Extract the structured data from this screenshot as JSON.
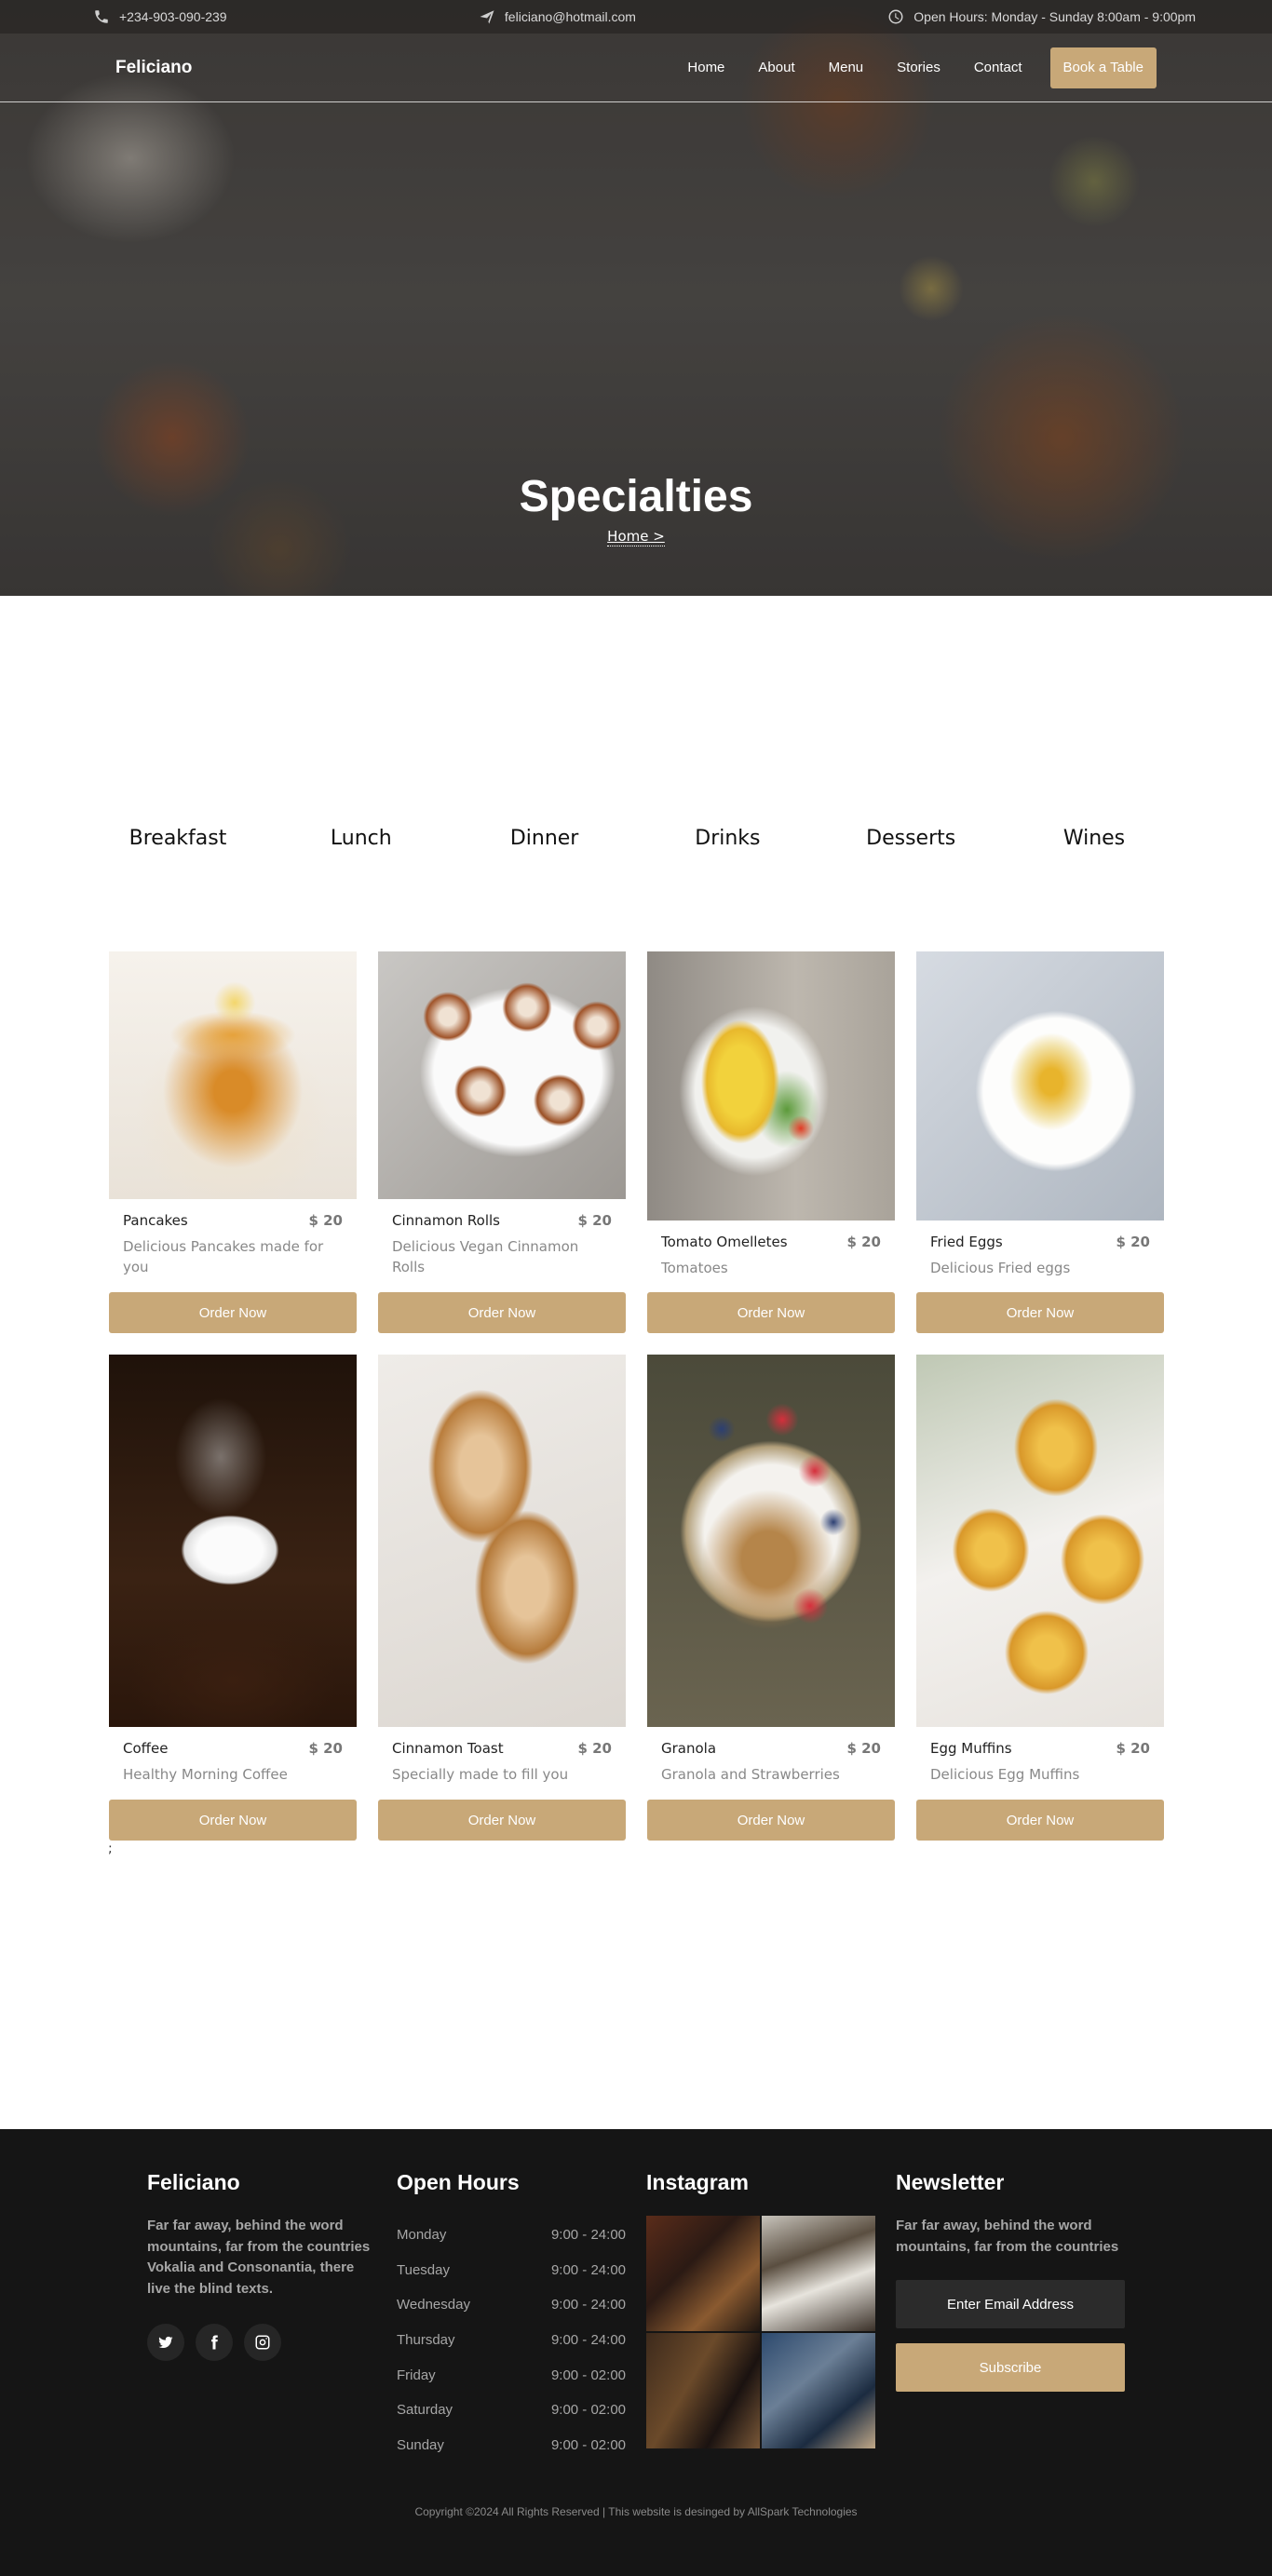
{
  "topbar": {
    "phone": "+234-903-090-239",
    "email": "feliciano@hotmail.com",
    "hours": "Open Hours: Monday - Sunday 8:00am - 9:00pm"
  },
  "nav": {
    "logo": "Feliciano",
    "items": [
      "Home",
      "About",
      "Menu",
      "Stories",
      "Contact"
    ],
    "cta": "Book a Table"
  },
  "hero": {
    "title": "Specialties",
    "breadcrumb": "Home >"
  },
  "tabs": [
    "Breakfast",
    "Lunch",
    "Dinner",
    "Drinks",
    "Desserts",
    "Wines"
  ],
  "menu": {
    "order_label": "Order Now",
    "items": [
      {
        "name": "Pancakes",
        "price": "$ 20",
        "desc": "Delicious Pancakes made for you",
        "photo": "pancakes"
      },
      {
        "name": "Cinnamon Rolls",
        "price": "$ 20",
        "desc": "Delicious Vegan Cinnamon Rolls",
        "photo": "cinnamon-rolls"
      },
      {
        "name": "Tomato Omelletes",
        "price": "$ 20",
        "desc": "Tomatoes",
        "photo": "tomato-omelette"
      },
      {
        "name": "Fried Eggs",
        "price": "$ 20",
        "desc": "Delicious Fried eggs",
        "photo": "fried-eggs"
      },
      {
        "name": "Coffee",
        "price": "$ 20",
        "desc": "Healthy Morning Coffee",
        "photo": "coffee"
      },
      {
        "name": "Cinnamon Toast",
        "price": "$ 20",
        "desc": "Specially made to fill you",
        "photo": "cinnamon-toast"
      },
      {
        "name": "Granola",
        "price": "$ 20",
        "desc": "Granola and Strawberries",
        "photo": "granola"
      },
      {
        "name": "Egg Muffins",
        "price": "$ 20",
        "desc": "Delicious Egg Muffins",
        "photo": "egg-muffins"
      }
    ]
  },
  "stray_text": ";",
  "footer": {
    "about": {
      "title": "Feliciano",
      "text": "Far far away, behind the word mountains, far from the countries Vokalia and Consonantia, there live the blind texts.",
      "social": [
        "twitter-icon",
        "facebook-icon",
        "instagram-icon"
      ]
    },
    "hours": {
      "title": "Open Hours",
      "rows": [
        {
          "day": "Monday",
          "time": "9:00 - 24:00"
        },
        {
          "day": "Tuesday",
          "time": "9:00 - 24:00"
        },
        {
          "day": "Wednesday",
          "time": "9:00 - 24:00"
        },
        {
          "day": "Thursday",
          "time": "9:00 - 24:00"
        },
        {
          "day": "Friday",
          "time": "9:00 - 02:00"
        },
        {
          "day": "Saturday",
          "time": "9:00 - 02:00"
        },
        {
          "day": "Sunday",
          "time": "9:00 - 02:00"
        }
      ]
    },
    "instagram": {
      "title": "Instagram"
    },
    "newsletter": {
      "title": "Newsletter",
      "text": "Far far away, behind the word mountains, far from the countries",
      "placeholder": "Enter Email Address",
      "button": "Subscribe"
    },
    "copyright": "Copyright ©2024 All Rights Reserved | This website is desinged by AllSpark Technologies"
  },
  "colors": {
    "accent": "#c8a878",
    "footer_bg": "#151515"
  }
}
